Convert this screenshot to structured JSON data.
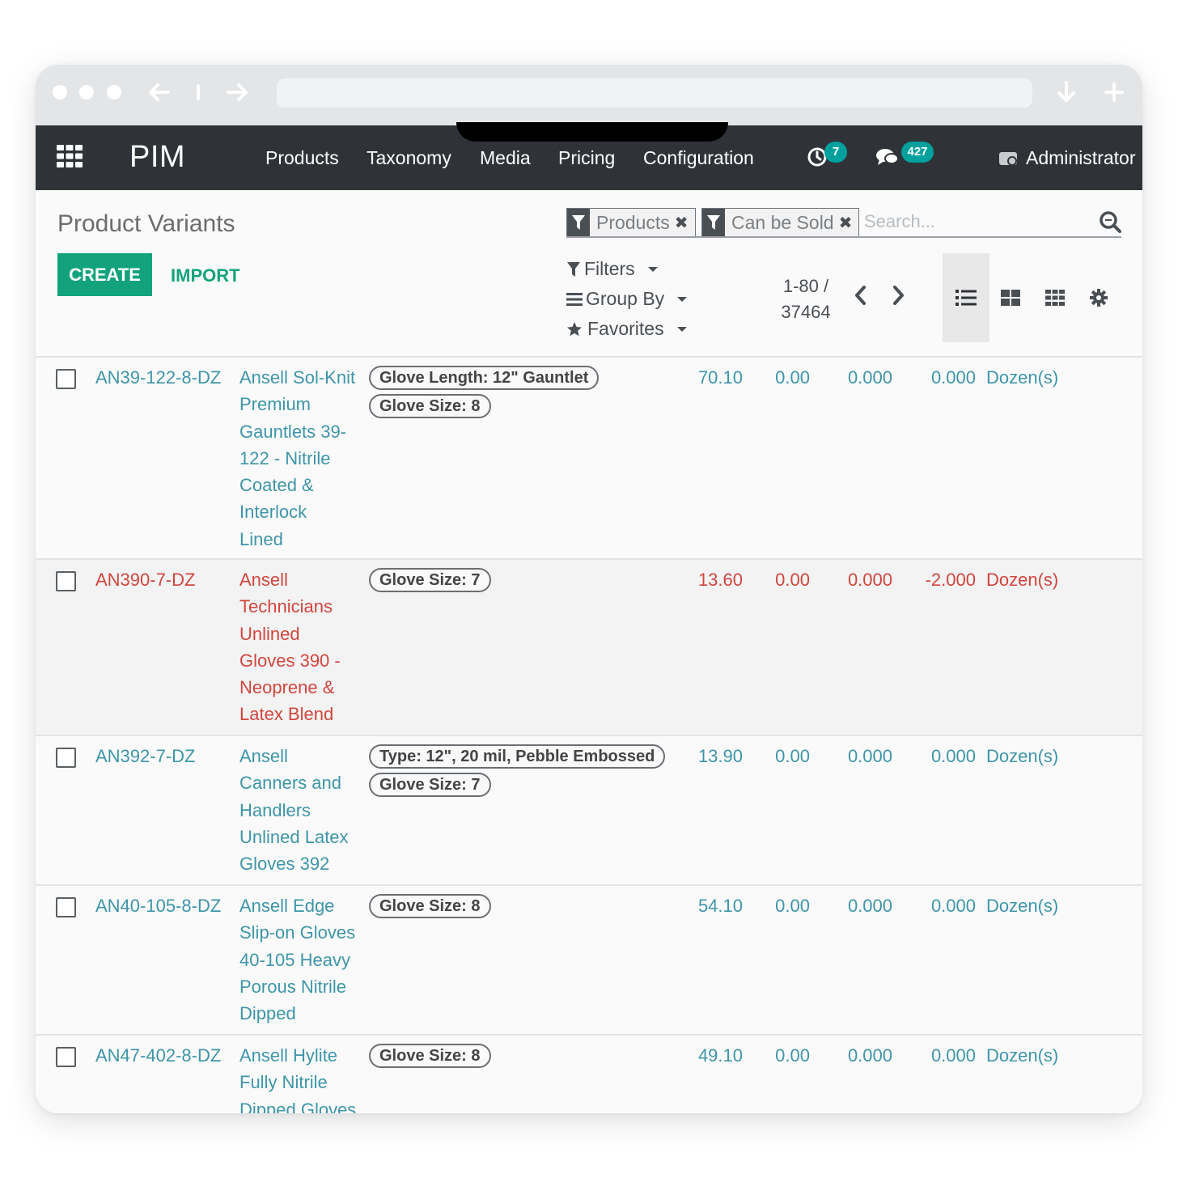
{
  "navbar": {
    "brand": "PIM",
    "menu": [
      "Products",
      "Taxonomy",
      "Media",
      "Pricing",
      "Configuration"
    ],
    "activity_count": "7",
    "message_count": "427",
    "user": "Administrator"
  },
  "control_panel": {
    "title": "Product Variants",
    "facets": [
      "Products",
      "Can be Sold"
    ],
    "search_placeholder": "Search...",
    "create_label": "CREATE",
    "import_label": "IMPORT",
    "filters_label": "Filters",
    "group_by_label": "Group By",
    "favorites_label": "Favorites",
    "pager_range": "1-80 /",
    "pager_total": "37464"
  },
  "rows": [
    {
      "ref": "AN39-122-8-DZ",
      "name_lines": [
        "Ansell Sol-Knit",
        "Premium",
        "Gauntlets 39-",
        "122 - Nitrile",
        "Coated &",
        "Interlock",
        "Lined"
      ],
      "tags": [
        "Glove Length: 12\" Gauntlet",
        "Glove Size: 8"
      ],
      "price": "70.10",
      "cost": "0.00",
      "on_hand": "0.000",
      "forecast": "0.000",
      "uom": "Dozen(s)",
      "status": "normal"
    },
    {
      "ref": "AN390-7-DZ",
      "name_lines": [
        "Ansell",
        "Technicians",
        "Unlined",
        "Gloves 390 -",
        "Neoprene &",
        "Latex Blend"
      ],
      "tags": [
        "Glove Size: 7"
      ],
      "price": "13.60",
      "cost": "0.00",
      "on_hand": "0.000",
      "forecast": "-2.000",
      "uom": "Dozen(s)",
      "status": "negative"
    },
    {
      "ref": "AN392-7-DZ",
      "name_lines": [
        "Ansell",
        "Canners and",
        "Handlers",
        "Unlined Latex",
        "Gloves 392"
      ],
      "tags": [
        "Type: 12\", 20 mil, Pebble Embossed",
        "Glove Size: 7"
      ],
      "price": "13.90",
      "cost": "0.00",
      "on_hand": "0.000",
      "forecast": "0.000",
      "uom": "Dozen(s)",
      "status": "normal"
    },
    {
      "ref": "AN40-105-8-DZ",
      "name_lines": [
        "Ansell Edge",
        "Slip-on Gloves",
        "40-105 Heavy",
        "Porous Nitrile",
        "Dipped"
      ],
      "tags": [
        "Glove Size: 8"
      ],
      "price": "54.10",
      "cost": "0.00",
      "on_hand": "0.000",
      "forecast": "0.000",
      "uom": "Dozen(s)",
      "status": "normal"
    },
    {
      "ref": "AN47-402-8-DZ",
      "name_lines": [
        "Ansell Hylite",
        "Fully Nitrile",
        "Dipped Gloves"
      ],
      "tags": [
        "Glove Size: 8"
      ],
      "price": "49.10",
      "cost": "0.00",
      "on_hand": "0.000",
      "forecast": "0.000",
      "uom": "Dozen(s)",
      "status": "normal"
    }
  ]
}
